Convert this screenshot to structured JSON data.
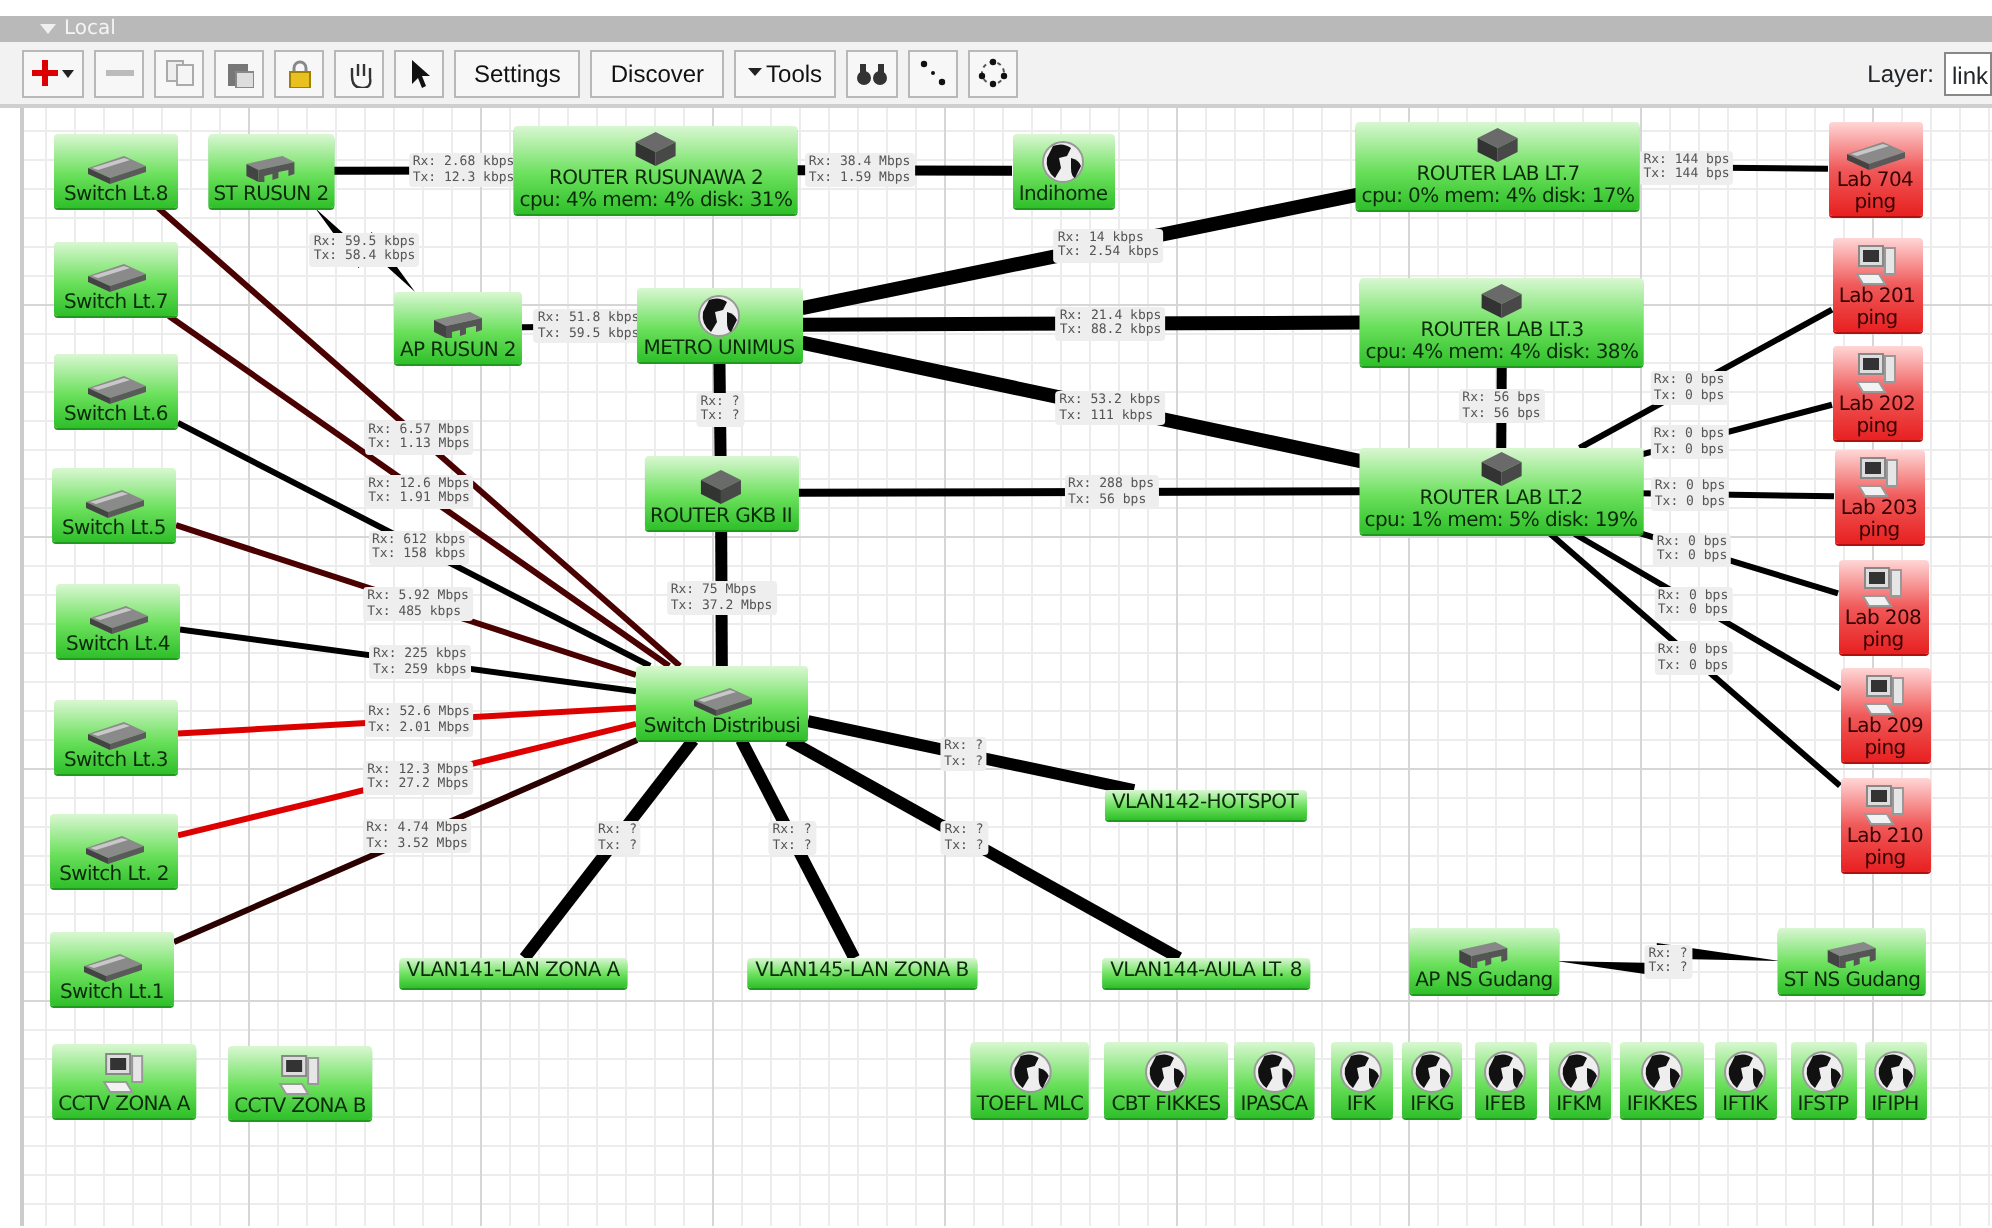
{
  "panel": {
    "title": "Local",
    "expanded": true
  },
  "toolbar": {
    "buttons": [
      {
        "label": "Settings",
        "kind": "text"
      },
      {
        "label": "Discover",
        "kind": "text"
      },
      {
        "label": "Tools",
        "kind": "menu"
      }
    ],
    "layer": {
      "label": "Layer:",
      "value": "link"
    }
  },
  "nodes": [
    {
      "name": "Switch Lt.8",
      "kind": "switch",
      "down": false
    },
    {
      "name": "ST RUSUN 2",
      "kind": "bridge",
      "down": false
    },
    {
      "name": "ROUTER RUSUNAWA 2",
      "stats": "cpu: 4% mem: 4% disk: 31%",
      "kind": "router",
      "down": false
    },
    {
      "name": "Indihome",
      "kind": "globe",
      "down": false
    },
    {
      "name": "ROUTER LAB LT.7",
      "stats": "cpu: 0% mem: 4% disk: 17%",
      "kind": "router",
      "down": false
    },
    {
      "name": "Lab 704",
      "stats": "ping",
      "kind": "switch",
      "down": true
    },
    {
      "name": "Switch Lt.7",
      "kind": "switch",
      "down": false
    },
    {
      "name": "AP RUSUN 2",
      "kind": "bridge",
      "down": false
    },
    {
      "name": "METRO UNIMUS",
      "kind": "globe",
      "down": false
    },
    {
      "name": "ROUTER LAB LT.3",
      "stats": "cpu: 4% mem: 4% disk: 38%",
      "kind": "router",
      "down": false
    },
    {
      "name": "Lab 201",
      "stats": "ping",
      "kind": "computer",
      "down": true
    },
    {
      "name": "Switch Lt.6",
      "kind": "switch",
      "down": false
    },
    {
      "name": "Lab 202",
      "stats": "ping",
      "kind": "computer",
      "down": true
    },
    {
      "name": "Switch Lt.5",
      "kind": "switch",
      "down": false
    },
    {
      "name": "ROUTER GKB II",
      "kind": "router",
      "down": false
    },
    {
      "name": "ROUTER LAB LT.2",
      "stats": "cpu: 1% mem: 5% disk: 19%",
      "kind": "router",
      "down": false
    },
    {
      "name": "Lab 203",
      "stats": "ping",
      "kind": "computer",
      "down": true
    },
    {
      "name": "Switch Lt.4",
      "kind": "switch",
      "down": false
    },
    {
      "name": "Lab 208",
      "stats": "ping",
      "kind": "computer",
      "down": true
    },
    {
      "name": "Switch Lt.3",
      "kind": "switch",
      "down": false
    },
    {
      "name": "Switch Distribusi",
      "kind": "switch",
      "down": false
    },
    {
      "name": "Lab 209",
      "stats": "ping",
      "kind": "computer",
      "down": true
    },
    {
      "name": "Switch Lt. 2",
      "kind": "switch",
      "down": false
    },
    {
      "name": "VLAN142-HOTSPOT",
      "kind": "plain",
      "down": false
    },
    {
      "name": "Lab 210",
      "stats": "ping",
      "kind": "computer",
      "down": true
    },
    {
      "name": "Switch Lt.1",
      "kind": "switch",
      "down": false
    },
    {
      "name": "VLAN141-LAN ZONA A",
      "kind": "plain",
      "down": false
    },
    {
      "name": "VLAN145-LAN ZONA B",
      "kind": "plain",
      "down": false
    },
    {
      "name": "VLAN144-AULA LT. 8",
      "kind": "plain",
      "down": false
    },
    {
      "name": "AP NS Gudang",
      "kind": "bridge",
      "down": false
    },
    {
      "name": "ST NS Gudang",
      "kind": "bridge",
      "down": false
    },
    {
      "name": "CCTV ZONA A",
      "kind": "computer",
      "down": false
    },
    {
      "name": "CCTV ZONA B",
      "kind": "computer",
      "down": false
    },
    {
      "name": "TOEFL MLC",
      "kind": "globe",
      "down": false
    },
    {
      "name": "CBT FIKKES",
      "kind": "globe",
      "down": false
    },
    {
      "name": "IPASCA",
      "kind": "globe",
      "down": false
    },
    {
      "name": "IFK",
      "kind": "globe",
      "down": false
    },
    {
      "name": "IFKG",
      "kind": "globe",
      "down": false
    },
    {
      "name": "IFEB",
      "kind": "globe",
      "down": false
    },
    {
      "name": "IFKM",
      "kind": "globe",
      "down": false
    },
    {
      "name": "IFIKKES",
      "kind": "globe",
      "down": false
    },
    {
      "name": "IFTIK",
      "kind": "globe",
      "down": false
    },
    {
      "name": "IFSTP",
      "kind": "globe",
      "down": false
    },
    {
      "name": "IFIPH",
      "kind": "globe",
      "down": false
    }
  ],
  "links": [
    {
      "kind": "wired",
      "color": "#000000",
      "rx": "Rx: 2.68 kbps",
      "tx": "Tx: 12.3 kbps"
    },
    {
      "kind": "wired",
      "color": "#000000",
      "rx": "Rx: 38.4 Mbps",
      "tx": "Tx: 1.59 Mbps"
    },
    {
      "kind": "wired",
      "color": "#000000",
      "rx": "Rx: 144 bps",
      "tx": "Tx: 144 bps"
    },
    {
      "kind": "wireless",
      "color": "#000000",
      "rx": "Rx: 59.5 kbps",
      "tx": "Tx: 58.4 kbps"
    },
    {
      "kind": "wired",
      "color": "#000000",
      "rx": "Rx: 14 kbps",
      "tx": "Tx: 2.54 kbps"
    },
    {
      "kind": "wired",
      "color": "#000000",
      "rx": "Rx: 51.8 kbps",
      "tx": "Tx: 59.5 kbps"
    },
    {
      "kind": "wired",
      "color": "#000000",
      "rx": "Rx: 21.4 kbps",
      "tx": "Tx: 88.2 kbps"
    },
    {
      "kind": "wired",
      "color": "#4a0000",
      "rx": "Rx: 6.57 Mbps",
      "tx": "Tx: 1.13 Mbps"
    },
    {
      "kind": "wired",
      "color": "#000000",
      "rx": "Rx: ?",
      "tx": "Tx: ?"
    },
    {
      "kind": "wired",
      "color": "#000000",
      "rx": "Rx: 53.2 kbps",
      "tx": "Tx: 111 kbps"
    },
    {
      "kind": "wired",
      "color": "#000000",
      "rx": "Rx: 56 bps",
      "tx": "Tx: 56 bps"
    },
    {
      "kind": "wired",
      "color": "#000000",
      "rx": "Rx: 0 bps",
      "tx": "Tx: 0 bps"
    },
    {
      "kind": "wired",
      "color": "#000000",
      "rx": "Rx: 0 bps",
      "tx": "Tx: 0 bps"
    },
    {
      "kind": "wired",
      "color": "#4a0000",
      "rx": "Rx: 12.6 Mbps",
      "tx": "Tx: 1.91 Mbps"
    },
    {
      "kind": "wired",
      "color": "#000000",
      "rx": "Rx: 288 bps",
      "tx": "Tx: 56 bps"
    },
    {
      "kind": "wired",
      "color": "#000000",
      "rx": "Rx: 0 bps",
      "tx": "Tx: 0 bps"
    },
    {
      "kind": "wired",
      "color": "#000000",
      "rx": "Rx: 612 kbps",
      "tx": "Tx: 158 kbps"
    },
    {
      "kind": "wired",
      "color": "#000000",
      "rx": "Rx: 0 bps",
      "tx": "Tx: 0 bps"
    },
    {
      "kind": "wired",
      "color": "#4a0000",
      "rx": "Rx: 5.92 Mbps",
      "tx": "Tx: 485 kbps"
    },
    {
      "kind": "wired",
      "color": "#000000",
      "rx": "Rx: 75 Mbps",
      "tx": "Tx: 37.2 Mbps"
    },
    {
      "kind": "wired",
      "color": "#000000",
      "rx": "Rx: 0 bps",
      "tx": "Tx: 0 bps"
    },
    {
      "kind": "wired",
      "color": "#000000",
      "rx": "Rx: 225 kbps",
      "tx": "Tx: 259 kbps"
    },
    {
      "kind": "wired",
      "color": "#000000",
      "rx": "Rx: 0 bps",
      "tx": "Tx: 0 bps"
    },
    {
      "kind": "wired",
      "color": "#dd0000",
      "rx": "Rx: 52.6 Mbps",
      "tx": "Tx: 2.01 Mbps"
    },
    {
      "kind": "wired",
      "color": "#dd0000",
      "rx": "Rx: 12.3 Mbps",
      "tx": "Tx: 27.2 Mbps"
    },
    {
      "kind": "wired",
      "color": "#000000",
      "rx": "Rx: ?",
      "tx": "Tx: ?"
    },
    {
      "kind": "wired",
      "color": "#2a0000",
      "rx": "Rx: 4.74 Mbps",
      "tx": "Tx: 3.52 Mbps"
    },
    {
      "kind": "wired",
      "color": "#000000",
      "rx": "Rx: ?",
      "tx": "Tx: ?"
    },
    {
      "kind": "wired",
      "color": "#000000",
      "rx": "Rx: ?",
      "tx": "Tx: ?"
    },
    {
      "kind": "wired",
      "color": "#000000",
      "rx": "Rx: ?",
      "tx": "Tx: ?"
    },
    {
      "kind": "wireless",
      "color": "#000000",
      "rx": "Rx: ?",
      "tx": "Tx: ?"
    }
  ]
}
